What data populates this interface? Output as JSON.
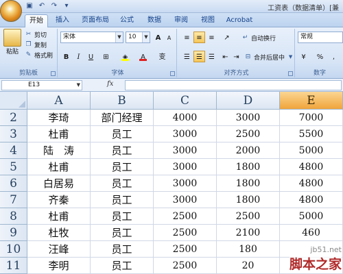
{
  "window": {
    "title": "工资表（数据清单）[兼"
  },
  "qat": {
    "save_icon": "save-icon",
    "undo_icon": "undo-icon",
    "redo_icon": "redo-icon"
  },
  "tabs": [
    {
      "label": "开始",
      "active": true
    },
    {
      "label": "插入"
    },
    {
      "label": "页面布局"
    },
    {
      "label": "公式"
    },
    {
      "label": "数据"
    },
    {
      "label": "审阅"
    },
    {
      "label": "视图"
    },
    {
      "label": "Acrobat"
    }
  ],
  "ribbon": {
    "clipboard": {
      "paste": "粘贴",
      "cut": "剪切",
      "copy": "复制",
      "format_painter": "格式刷",
      "group_label": "剪贴板"
    },
    "font": {
      "font_name": "宋体",
      "font_size": "10",
      "bold": "B",
      "italic": "I",
      "underline": "U",
      "grow": "A",
      "shrink": "A",
      "font_color_glyph": "A",
      "phonetic_glyph": "变",
      "group_label": "字体"
    },
    "alignment": {
      "wrap_text": "自动换行",
      "merge_center": "合并后居中",
      "group_label": "对齐方式"
    },
    "number": {
      "format": "常规",
      "currency": "%",
      "comma": ",",
      "group_label": "数字"
    }
  },
  "formula_bar": {
    "name_box": "E13",
    "fx": "fx",
    "formula": ""
  },
  "sheet": {
    "columns": [
      "A",
      "B",
      "C",
      "D",
      "E"
    ],
    "selected_column": "E",
    "rows": [
      {
        "row": "2",
        "cells": [
          "李琦",
          "部门经理",
          "4000",
          "3000",
          "7000"
        ]
      },
      {
        "row": "3",
        "cells": [
          "杜甫",
          "员工",
          "3000",
          "2500",
          "5500"
        ]
      },
      {
        "row": "4",
        "cells": [
          "陆　涛",
          "员工",
          "3000",
          "2000",
          "5000"
        ]
      },
      {
        "row": "5",
        "cells": [
          "杜甫",
          "员工",
          "3000",
          "1800",
          "4800"
        ]
      },
      {
        "row": "6",
        "cells": [
          "白居易",
          "员工",
          "3000",
          "1800",
          "4800"
        ]
      },
      {
        "row": "7",
        "cells": [
          "齐秦",
          "员工",
          "3000",
          "1800",
          "4800"
        ]
      },
      {
        "row": "8",
        "cells": [
          "杜甫",
          "员工",
          "2500",
          "2500",
          "5000"
        ]
      },
      {
        "row": "9",
        "cells": [
          "杜牧",
          "员工",
          "2500",
          "2100",
          "460"
        ]
      },
      {
        "row": "10",
        "cells": [
          "汪峰",
          "员工",
          "2500",
          "180",
          ""
        ]
      },
      {
        "row": "11",
        "cells": [
          "李明",
          "员工",
          "2500",
          "20",
          ""
        ]
      }
    ]
  },
  "watermark": {
    "url": "jb51.net",
    "name": "脚本之家"
  },
  "colors": {
    "selected_header": "#f0a43b",
    "ribbon": "#d6e4f6",
    "gridline": "#d0d7e5"
  }
}
